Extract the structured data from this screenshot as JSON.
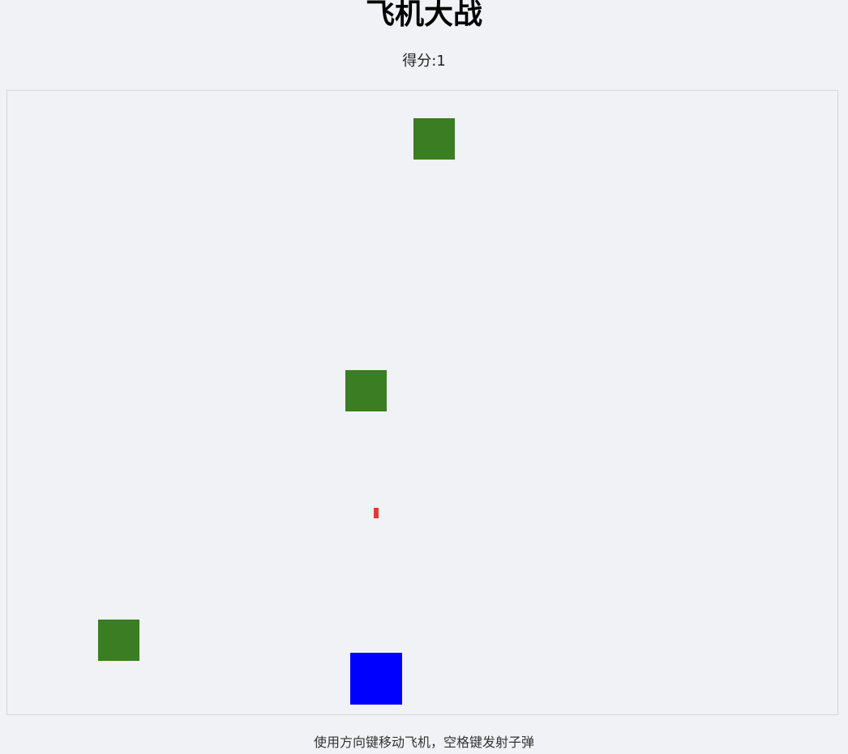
{
  "header": {
    "title": "飞机大战"
  },
  "score": {
    "label": "得分:",
    "value": "1"
  },
  "footer": {
    "instructions": "使用方向键移动飞机，空格键发射子弹"
  },
  "colors": {
    "enemy": "#3a7d22",
    "player": "#0000ff",
    "bullet": "#e53935",
    "background": "#f0f2f5"
  },
  "game": {
    "enemies": [
      {
        "id": "enemy-1"
      },
      {
        "id": "enemy-2"
      },
      {
        "id": "enemy-3"
      }
    ],
    "bullets": [
      {
        "id": "bullet-1"
      }
    ],
    "player": {
      "id": "player-plane"
    }
  }
}
